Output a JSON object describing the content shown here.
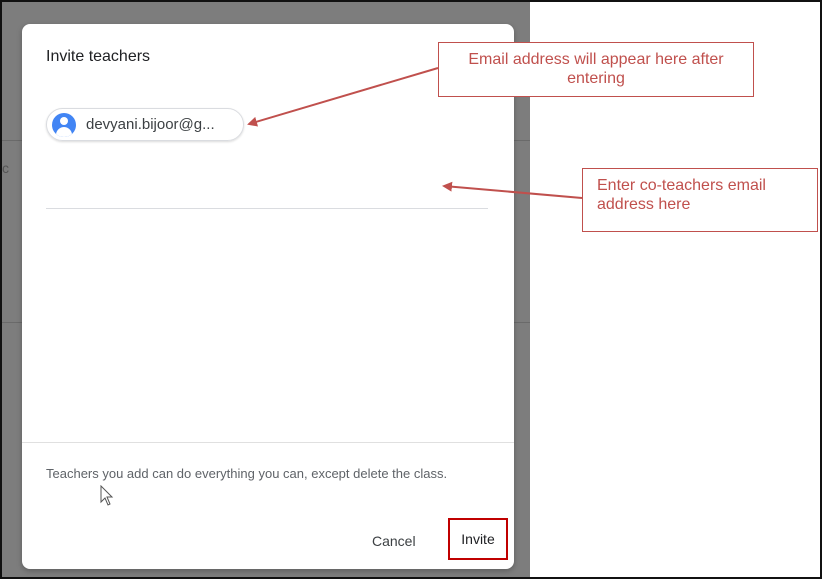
{
  "dialog": {
    "title": "Invite teachers",
    "chip_email": "devyani.bijoor@g...",
    "input_value": "",
    "footer_note": "Teachers you add can do everything you can, except delete the class.",
    "cancel_label": "Cancel",
    "invite_label": "Invite"
  },
  "annotations": {
    "callout_chip": "Email address will appear here after entering",
    "callout_input": "Enter co-teachers email address here"
  },
  "colors": {
    "annotation_red": "#c0504d",
    "invite_highlight": "#c00000",
    "avatar_blue": "#4285f4"
  },
  "icons": [
    "avatar-icon",
    "cursor-icon"
  ]
}
